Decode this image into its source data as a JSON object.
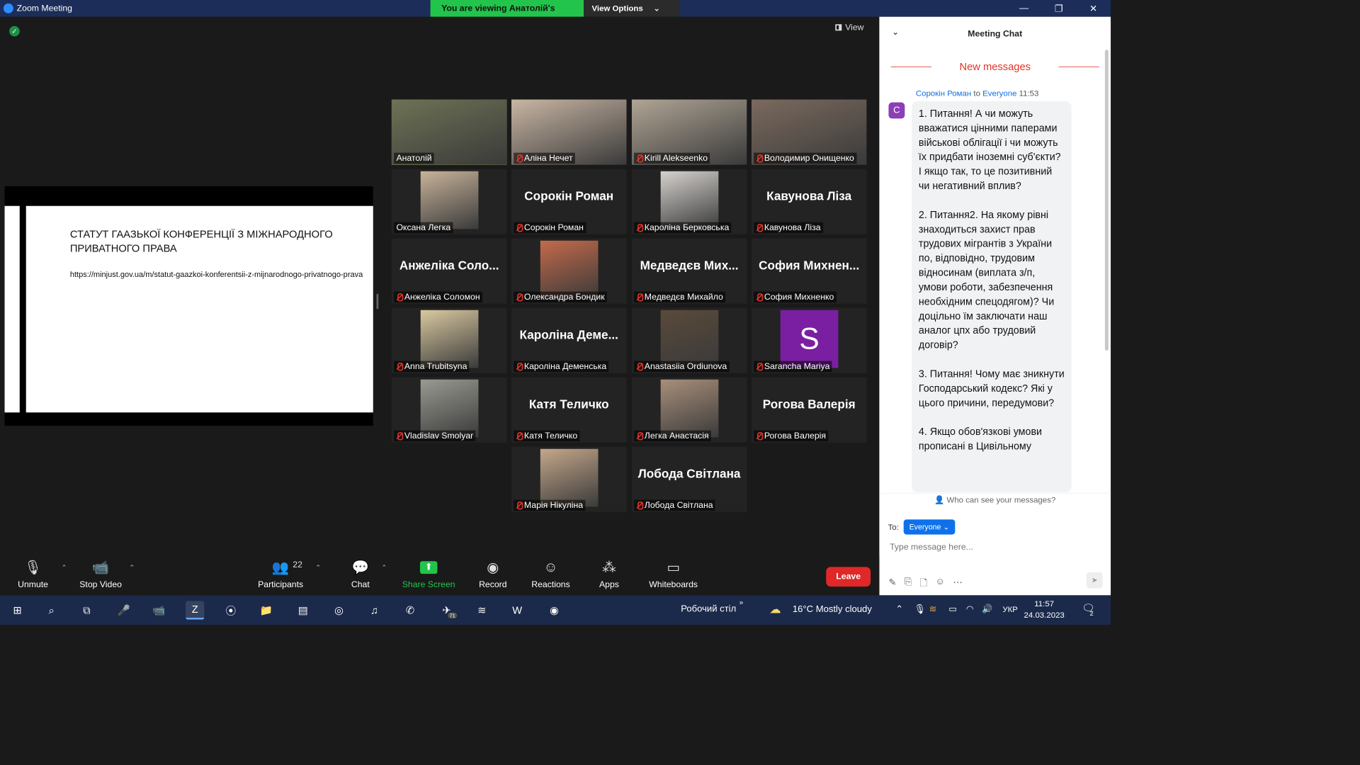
{
  "window": {
    "title": "Zoom Meeting",
    "banner": "You are viewing Анатолій's screen",
    "view_options": "View Options",
    "view_options_caret": "⌄",
    "minimize": "—",
    "restore": "❐",
    "close": "✕"
  },
  "meeting": {
    "view_label": "View",
    "shared_slide": {
      "title": "СТАТУТ ГААЗЬКОЇ КОНФЕРЕНЦІЇ З МІЖНАРОДНОГО ПРИВАТНОГО ПРАВА",
      "link": "https://minjust.gov.ua/m/statut-gaazkoi-konferentsii-z-mijnarodnogo-privatnogo-prava"
    },
    "participants": [
      {
        "name": "Анатолій",
        "display": "",
        "muted": false,
        "active": true,
        "video": true,
        "photo_color": "#6d7355"
      },
      {
        "name": "Аліна Нечет",
        "display": "",
        "muted": true,
        "video": true,
        "photo_color": "#c9b6a4"
      },
      {
        "name": "Kirill Alekseenko",
        "display": "",
        "muted": true,
        "video": true,
        "photo_color": "#b0a595"
      },
      {
        "name": "Володимир Онищенко",
        "display": "",
        "muted": true,
        "video": true,
        "photo_color": "#7b6a5e"
      },
      {
        "name": "Оксана Легка",
        "display": "",
        "muted": false,
        "video": true,
        "photo_color": "#c8b39a"
      },
      {
        "name": "Сорокін Роман",
        "display": "Сорокін Роман",
        "muted": true,
        "video": false
      },
      {
        "name": "Кароліна Берковська",
        "display": "",
        "muted": true,
        "video": true,
        "photo_color": "#d6d2ce"
      },
      {
        "name": "Кавунова Ліза",
        "display": "Кавунова Ліза",
        "muted": true,
        "video": false
      },
      {
        "name": "Анжеліка Соломон",
        "display": "Анжеліка Соло...",
        "muted": true,
        "video": false
      },
      {
        "name": "Олександра Бондик",
        "display": "",
        "muted": true,
        "video": true,
        "photo_color": "#c46a4a"
      },
      {
        "name": "Медведєв Михайло",
        "display": "Медведєв Мих...",
        "muted": true,
        "video": false
      },
      {
        "name": "София Михненко",
        "display": "София Михнен...",
        "muted": true,
        "video": false
      },
      {
        "name": "Anna Trubitsyna",
        "display": "",
        "muted": true,
        "video": true,
        "photo_color": "#d9c9a0"
      },
      {
        "name": "Кароліна Деменська",
        "display": "Кароліна Деме...",
        "muted": true,
        "video": false
      },
      {
        "name": "Anastasiia Ordiunova",
        "display": "",
        "muted": true,
        "video": true,
        "photo_color": "#5a4a3a"
      },
      {
        "name": "Sarancha Mariya",
        "display": "S",
        "muted": true,
        "video": false,
        "avatar": true
      },
      {
        "name": "Vladislav Smolyar",
        "display": "",
        "muted": true,
        "video": true,
        "photo_color": "#9a9a92"
      },
      {
        "name": "Катя Теличко",
        "display": "Катя Теличко",
        "muted": true,
        "video": false
      },
      {
        "name": "Легка Анастасія",
        "display": "",
        "muted": true,
        "video": true,
        "photo_color": "#a98f7a"
      },
      {
        "name": "Рогова Валерія",
        "display": "Рогова Валерія",
        "muted": true,
        "video": false
      },
      {
        "name": "Марія Нікуліна",
        "display": "",
        "muted": true,
        "video": true,
        "photo_color": "#c4a78a"
      },
      {
        "name": "Лобода Світлана",
        "display": "Лобода Світлана",
        "muted": true,
        "video": false
      }
    ]
  },
  "chat": {
    "title": "Meeting Chat",
    "new_messages": "New messages",
    "message": {
      "sender": "Сорокін Роман",
      "to_word": "to",
      "to": "Everyone",
      "time": "11:53",
      "avatar_letter": "С",
      "text": "1. Питання! А чи можуть вважатися цінними паперами військові облігації і чи можуть їх придбати іноземні суб'єкти? І якщо так, то це позитивний чи негативний вплив?\n\n2. Питання2. На якому рівні знаходиться захист прав трудових мігрантів з України по, відповідно, трудовим відносинам (виплата з/п, умови роботи, забезпечення необхідним спецодягом)? Чи доцільно їм заключати наш аналог цпх або трудовий договір?\n\n3. Питання! Чому має зникнути Господарський кодекс? Які у цього причини, передумови?\n\n4. Якщо обов'язкові умови прописані в Цивільному"
    },
    "who_can_see": "Who can see your messages?",
    "to_label": "To:",
    "to_value": "Everyone",
    "input_placeholder": "Type message here..."
  },
  "toolbar": {
    "unmute": "Unmute",
    "stop_video": "Stop Video",
    "participants": "Participants",
    "participants_count": "22",
    "chat": "Chat",
    "share_screen": "Share Screen",
    "record": "Record",
    "reactions": "Reactions",
    "apps": "Apps",
    "whiteboards": "Whiteboards",
    "leave": "Leave"
  },
  "taskbar": {
    "desktop_label": "Робочий стіл",
    "weather": "16°C  Mostly cloudy",
    "language": "УКР",
    "time": "11:57",
    "date": "24.03.2023",
    "notifications": "2",
    "telegram_badge": "71"
  }
}
